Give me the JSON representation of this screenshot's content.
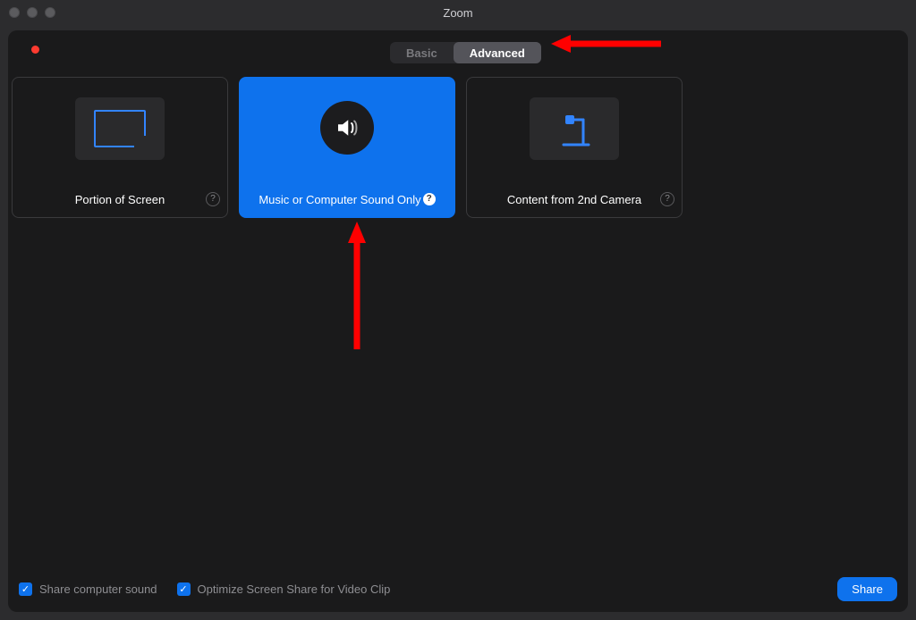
{
  "window": {
    "title": "Zoom"
  },
  "tabs": {
    "basic": "Basic",
    "advanced": "Advanced",
    "active": "advanced"
  },
  "cards": {
    "portion": {
      "label": "Portion of Screen"
    },
    "sound": {
      "label": "Music or Computer Sound Only"
    },
    "camera2": {
      "label": "Content from 2nd Camera"
    }
  },
  "footer": {
    "share_sound": "Share computer sound",
    "optimize_clip": "Optimize Screen Share for Video Clip",
    "share_btn": "Share"
  },
  "colors": {
    "accent": "#0e72ed",
    "annotation": "#ff0000"
  }
}
